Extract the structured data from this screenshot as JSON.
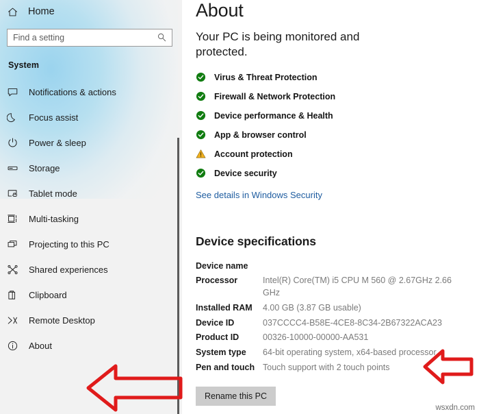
{
  "sidebar": {
    "home": {
      "label": "Home",
      "icon": "home-icon"
    },
    "search": {
      "placeholder": "Find a setting",
      "value": "",
      "icon": "search-icon"
    },
    "group_header": "System",
    "items": [
      {
        "label": "Notifications & actions",
        "icon": "notification-icon"
      },
      {
        "label": "Focus assist",
        "icon": "moon-icon"
      },
      {
        "label": "Power & sleep",
        "icon": "power-icon"
      },
      {
        "label": "Storage",
        "icon": "storage-icon"
      },
      {
        "label": "Tablet mode",
        "icon": "tablet-icon"
      },
      {
        "label": "Multi-tasking",
        "icon": "multitasking-icon"
      },
      {
        "label": "Projecting to this PC",
        "icon": "projecting-icon"
      },
      {
        "label": "Shared experiences",
        "icon": "share-icon"
      },
      {
        "label": "Clipboard",
        "icon": "clipboard-icon"
      },
      {
        "label": "Remote Desktop",
        "icon": "remote-desktop-icon"
      },
      {
        "label": "About",
        "icon": "info-icon"
      }
    ]
  },
  "main": {
    "title": "About",
    "status_heading": "Your PC is being monitored and protected.",
    "status_items": [
      {
        "label": "Virus & Threat Protection",
        "state": "ok"
      },
      {
        "label": "Firewall & Network Protection",
        "state": "ok"
      },
      {
        "label": "Device performance & Health",
        "state": "ok"
      },
      {
        "label": "App & browser control",
        "state": "ok"
      },
      {
        "label": "Account protection",
        "state": "warning"
      },
      {
        "label": "Device security",
        "state": "ok"
      }
    ],
    "security_link": "See details in Windows Security",
    "specs_title": "Device specifications",
    "specs": [
      {
        "key": "Device name",
        "value": ""
      },
      {
        "key": "Processor",
        "value": "Intel(R) Core(TM) i5 CPU      M 560  @ 2.67GHz  2.66 GHz"
      },
      {
        "key": "Installed RAM",
        "value": "4.00 GB (3.87 GB usable)"
      },
      {
        "key": "Device ID",
        "value": "037CCCC4-B58E-4CE8-8C34-2B67322ACA23"
      },
      {
        "key": "Product ID",
        "value": "00326-10000-00000-AA531"
      },
      {
        "key": "System type",
        "value": "64-bit operating system, x64-based processor"
      },
      {
        "key": "Pen and touch",
        "value": "Touch support with 2 touch points"
      }
    ],
    "rename_button": "Rename this PC"
  },
  "annotations": {
    "arrow_about": "left-arrow-pointing-at-about",
    "arrow_system_type": "left-arrow-pointing-at-system-type"
  },
  "watermark": "wsxdn.com",
  "colors": {
    "accent_link": "#1f5da0",
    "status_ok": "#107c10",
    "status_warning": "#f2b01e",
    "annotation_red": "#e01b1b",
    "sidebar_bg": "#f2f2f2",
    "button_bg": "#cccccc"
  }
}
